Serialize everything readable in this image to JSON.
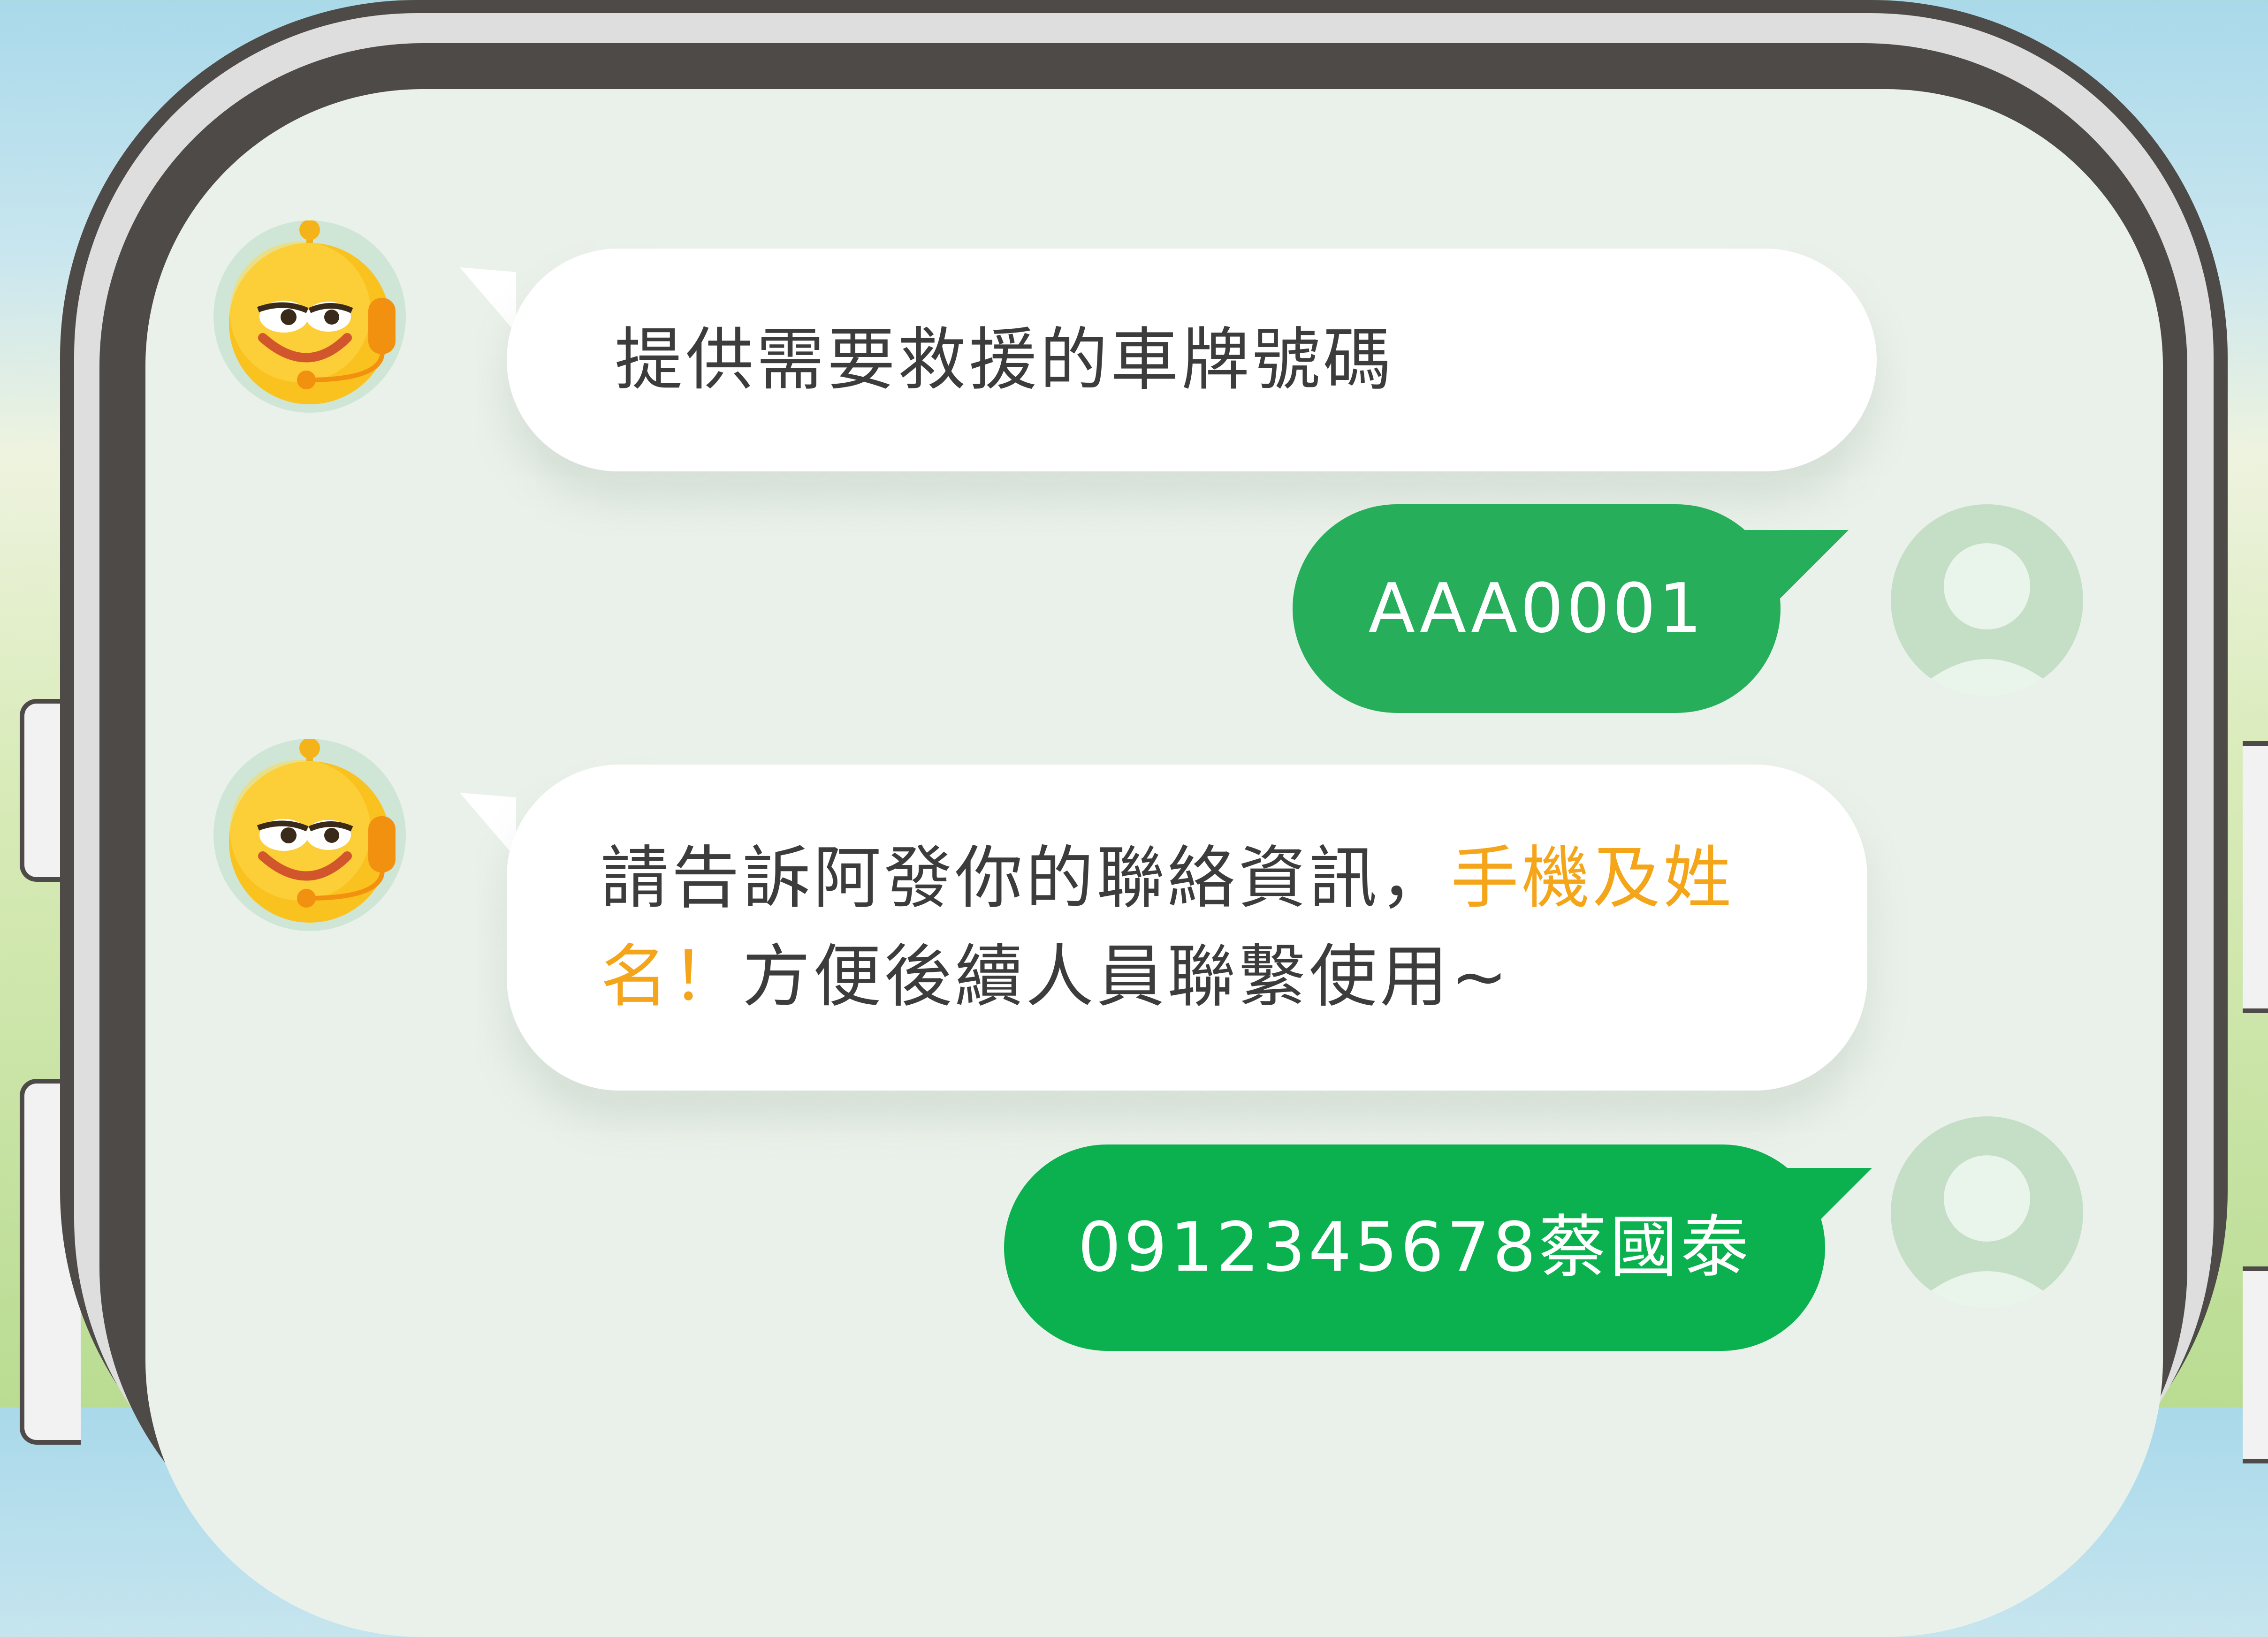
{
  "colors": {
    "bot_bubble": "#ffffff",
    "user_bubble_1": "#27ae5b",
    "user_bubble_2": "#0bb14e",
    "highlight": "#f4a51a",
    "text_dark": "#3c3c3c",
    "screen_bg": "#eaf1ea"
  },
  "icons": {
    "bot": "robot-mascot-icon",
    "user": "user-silhouette-icon"
  },
  "messages": [
    {
      "sender": "bot",
      "text": "提供需要救援的車牌號碼"
    },
    {
      "sender": "user",
      "text": "AAA0001"
    },
    {
      "sender": "bot",
      "parts": [
        {
          "text": "請告訴阿發你的聯絡資訊，",
          "highlight": false
        },
        {
          "text": "手機及姓名！",
          "highlight": true
        },
        {
          "text": "方便後續人員聯繫使用~",
          "highlight": false
        }
      ]
    },
    {
      "sender": "user",
      "text": "0912345678蔡國泰"
    }
  ]
}
